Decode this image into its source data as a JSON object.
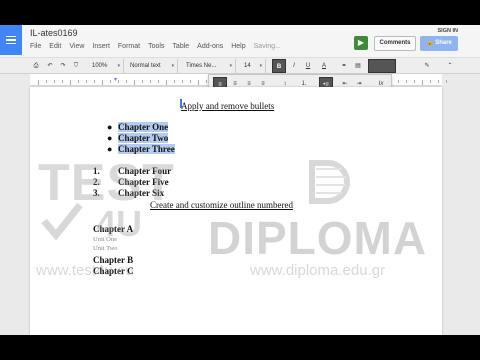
{
  "app": {
    "document_title": "IL-ates0169",
    "signin_label": "SIGN IN",
    "present_icon": "present-icon",
    "comments_label": "Comments",
    "share_label": "Share",
    "share_icon": "lock-icon"
  },
  "menu": {
    "items": [
      "File",
      "Edit",
      "View",
      "Insert",
      "Format",
      "Tools",
      "Table",
      "Add-ons",
      "Help"
    ],
    "status": "Saving..."
  },
  "toolbar": {
    "icons": [
      "print-icon",
      "undo-icon",
      "redo-icon",
      "paint-format-icon"
    ],
    "zoom": "100%",
    "style": "Normal text",
    "font": "Times Ne...",
    "size": "14",
    "bold": "B",
    "italic": "I",
    "underline": "U",
    "text_color": "A"
  },
  "toolbar2": {
    "icons": [
      "align-left-icon",
      "align-center-icon",
      "align-right-icon",
      "align-justify-icon",
      "line-spacing-icon",
      "numbered-list-icon",
      "bulleted-list-icon",
      "decrease-indent-icon",
      "increase-indent-icon",
      "clear-formatting-icon"
    ]
  },
  "document": {
    "heading1": "Apply and remove bullets",
    "bullets": [
      "Chapter One",
      "Chapter Two",
      "Chapter Three"
    ],
    "numbered": [
      {
        "num": "1.",
        "text": "Chapter Four"
      },
      {
        "num": "2.",
        "text": "Chapter Five"
      },
      {
        "num": "3.",
        "text": "Chapter Six"
      }
    ],
    "heading2": "Create and customize outline numbered",
    "outline": [
      {
        "text": "Chapter A",
        "level": 1
      },
      {
        "text": "Unit One",
        "level": 2
      },
      {
        "text": "Unit Two",
        "level": 2
      },
      {
        "text": "Chapter B",
        "level": 1
      },
      {
        "text": "Chapter C",
        "level": 1
      }
    ]
  },
  "watermark": {
    "test4u_text": "TEST",
    "test4u_num": "4U",
    "diploma_text": "DIPLOMA",
    "url1": "www.test4u.eu",
    "url2": "www.diploma.edu.gr"
  },
  "colors": {
    "accent_blue": "#4285f4",
    "selection": "#b3cbee",
    "present_green": "#3c8a3a",
    "share_blue": "#8fb4ee"
  }
}
